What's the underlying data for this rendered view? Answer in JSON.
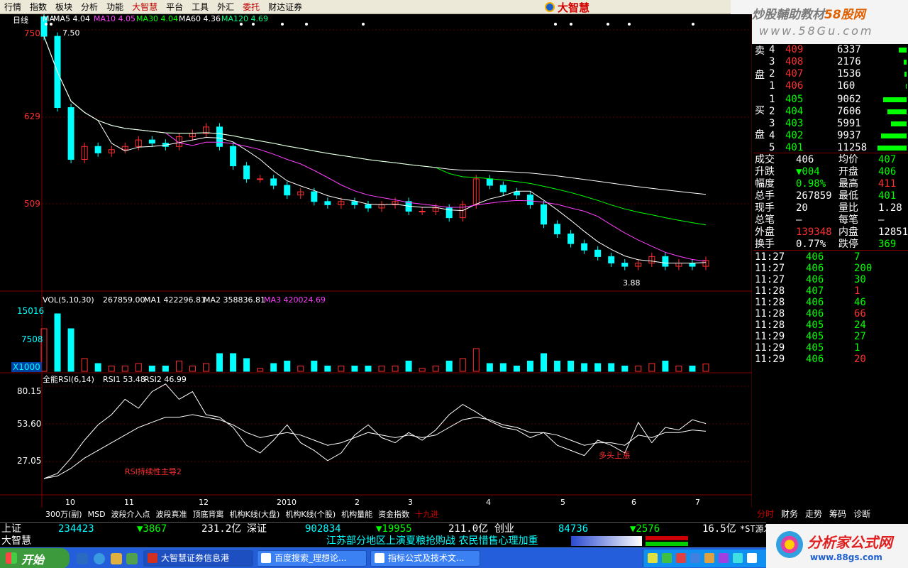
{
  "menu": {
    "items": [
      "行情",
      "指数",
      "板块",
      "分析",
      "功能",
      "大智慧",
      "平台",
      "工具",
      "外汇",
      "委托",
      "财达证券"
    ],
    "highlight": [
      "大智慧",
      "委托"
    ]
  },
  "logo": {
    "text": "大智慧"
  },
  "watermark_top": {
    "line1_a": "炒股輔助教材",
    "line1_b": "58股网",
    "line2": "www.58Gu.com"
  },
  "chart": {
    "period_label": "日线",
    "ma_legend": [
      {
        "name": "MA",
        "text": "MA",
        "color": "#ffffff"
      },
      {
        "name": "MA5",
        "text": "MA5 4.04",
        "color": "#ffffff"
      },
      {
        "name": "MA10",
        "text": "MA10 4.05",
        "color": "#ff40ff"
      },
      {
        "name": "MA30",
        "text": "MA30 4.04",
        "color": "#00ff00"
      },
      {
        "name": "MA60",
        "text": "MA60 4.36",
        "color": "#ffffff"
      },
      {
        "name": "MA120",
        "text": "MA120 4.69",
        "color": "#00ff80"
      }
    ],
    "price_axis": [
      "750",
      "629",
      "509"
    ],
    "high_label": "7.50",
    "low_label": "3.88",
    "vol_legend": {
      "title": "VOL(5,10,30)",
      "v": "267859.00",
      "ma1": "MA1 422296.81",
      "ma2": "MA2 358836.81",
      "ma3": "MA3 420024.69"
    },
    "vol_axis": [
      "15016",
      "7508",
      "X1000"
    ],
    "rsi_legend": {
      "title": "全能RSI(6,14)",
      "rsi1": "RSI1 53.48",
      "rsi2": "RSI2 46.99"
    },
    "rsi_axis": [
      "80.15",
      "53.60",
      "27.05"
    ],
    "rsi_annotations": [
      "RSI持续性主导2",
      "多头上漲"
    ],
    "date_axis": [
      "10",
      "11",
      "12",
      "2010",
      "2",
      "3",
      "4",
      "5",
      "6",
      "7"
    ]
  },
  "chart_data": {
    "type": "line",
    "title": "",
    "price_series": [
      7.5,
      6.4,
      5.6,
      5.8,
      5.7,
      5.75,
      5.8,
      5.9,
      5.85,
      5.8,
      5.95,
      6.0,
      6.1,
      5.8,
      5.5,
      5.3,
      5.3,
      5.2,
      5.05,
      5.1,
      4.95,
      4.9,
      4.95,
      4.9,
      4.85,
      4.9,
      4.95,
      4.8,
      4.8,
      4.85,
      4.7,
      4.9,
      5.3,
      5.2,
      5.1,
      5.05,
      4.9,
      4.6,
      4.45,
      4.3,
      4.2,
      4.1,
      4.0,
      3.95,
      4.0,
      4.1,
      3.95,
      4.0,
      3.95,
      4.04
    ],
    "ylim": [
      3.6,
      7.6
    ],
    "rsi1": [
      10,
      14,
      26,
      40,
      52,
      60,
      72,
      65,
      78,
      84,
      72,
      78,
      60,
      58,
      50,
      36,
      30,
      40,
      52,
      38,
      32,
      24,
      30,
      44,
      52,
      42,
      38,
      46,
      40,
      48,
      60,
      68,
      62,
      55,
      50,
      48,
      42,
      46,
      36,
      32,
      28,
      40,
      36,
      30,
      54,
      38,
      50,
      48,
      56,
      53
    ],
    "rsi2": [
      10,
      12,
      18,
      26,
      32,
      38,
      44,
      50,
      54,
      58,
      58,
      60,
      58,
      56,
      52,
      46,
      42,
      44,
      46,
      44,
      40,
      36,
      38,
      42,
      46,
      44,
      42,
      44,
      42,
      44,
      50,
      56,
      58,
      56,
      52,
      50,
      46,
      46,
      44,
      40,
      36,
      38,
      38,
      36,
      44,
      42,
      46,
      46,
      48,
      47
    ],
    "rsi_ylim": [
      0,
      100
    ]
  },
  "bottom_tabs": [
    "300万(副)",
    "MSD",
    "波段介入点",
    "波段真准",
    "顶底背离",
    "机构K线(大盘)",
    "机构K线(个股)",
    "机构量能",
    "资金指数",
    "十九进"
  ],
  "bottom_active": "十九进",
  "right_tabs": [
    "分时",
    "财务",
    "走势",
    "筹码",
    "诊断"
  ],
  "quotes": {
    "sell_label": [
      "卖",
      "盘"
    ],
    "buy_label": [
      "买",
      "盘"
    ],
    "sell": [
      {
        "n": "4",
        "price": "409",
        "vol": "6337",
        "bar": 0.2
      },
      {
        "n": "3",
        "price": "408",
        "vol": "2176",
        "bar": 0.07
      },
      {
        "n": "2",
        "price": "407",
        "vol": "1536",
        "bar": 0.05
      },
      {
        "n": "1",
        "price": "406",
        "vol": "160",
        "bar": 0.02
      }
    ],
    "buy": [
      {
        "n": "1",
        "price": "405",
        "vol": "9062",
        "bar": 0.6
      },
      {
        "n": "2",
        "price": "404",
        "vol": "7606",
        "bar": 0.5
      },
      {
        "n": "3",
        "price": "403",
        "vol": "5991",
        "bar": 0.4
      },
      {
        "n": "4",
        "price": "402",
        "vol": "9937",
        "bar": 0.65
      },
      {
        "n": "5",
        "price": "401",
        "vol": "11258",
        "bar": 0.75
      }
    ],
    "stats": [
      {
        "l": "成交",
        "v": "406",
        "l2": "均价",
        "v2": "407"
      },
      {
        "l": "升跌",
        "v": "▼004",
        "l2": "开盘",
        "v2": "406"
      },
      {
        "l": "幅度",
        "v": "0.98%",
        "l2": "最高",
        "v2": "411"
      },
      {
        "l": "总手",
        "v": "267859",
        "l2": "最低",
        "v2": "401"
      },
      {
        "l": "现手",
        "v": "20",
        "l2": "量比",
        "v2": "1.28"
      },
      {
        "l": "总笔",
        "v": "—",
        "l2": "每笔",
        "v2": "—"
      },
      {
        "l": "外盘",
        "v": "139348",
        "l2": "内盘",
        "v2": "128511"
      },
      {
        "l": "换手",
        "v": "0.77%",
        "l2": "跌停",
        "v2": "369"
      }
    ],
    "ticks": [
      {
        "t": "11:27",
        "p": "406",
        "v": "7",
        "c": "#00ff00"
      },
      {
        "t": "11:27",
        "p": "406",
        "v": "200",
        "c": "#00ff00"
      },
      {
        "t": "11:27",
        "p": "406",
        "v": "30",
        "c": "#00ff00"
      },
      {
        "t": "11:28",
        "p": "407",
        "v": "1",
        "c": "#ff3030"
      },
      {
        "t": "11:28",
        "p": "406",
        "v": "46",
        "c": "#00ff00"
      },
      {
        "t": "11:28",
        "p": "406",
        "v": "66",
        "c": "#ff3030"
      },
      {
        "t": "11:28",
        "p": "405",
        "v": "24",
        "c": "#00ff00"
      },
      {
        "t": "11:29",
        "p": "405",
        "v": "27",
        "c": "#00ff00"
      },
      {
        "t": "11:29",
        "p": "405",
        "v": "1",
        "c": "#00ff00"
      },
      {
        "t": "11:29",
        "p": "406",
        "v": "20",
        "c": "#ff3030"
      }
    ]
  },
  "index_bar": {
    "sh_label": "上证",
    "sh_vol": "234423",
    "sh_chg": "▼3867",
    "sh_amt": "231.2亿",
    "sz_label": "深证",
    "sz_vol": "902834",
    "sz_chg": "▼19955",
    "sz_amt": "211.0亿",
    "cy_label": "创业",
    "cy_vol": "84736",
    "cy_chg": "▼2576",
    "cy_amt": "16.5亿",
    "st_label": "*ST源发"
  },
  "ticker": {
    "left": "大智慧",
    "news": "江苏部分地区上演夏粮抢购战 农民惜售心理加重"
  },
  "taskbar": {
    "start": "开始",
    "tasks": [
      "大智慧证券信息港",
      "百度搜索_理想论...",
      "指标公式及技术文..."
    ]
  },
  "watermark_bottom": {
    "t1": "分析家公式网",
    "t2": "www.88gs.com"
  },
  "colors": {
    "up": "#ff3030",
    "down": "#00ffff",
    "grid": "#800000",
    "ma_green": "#00ff00",
    "ma_white": "#ffffff",
    "ma_pink": "#ff40ff"
  }
}
